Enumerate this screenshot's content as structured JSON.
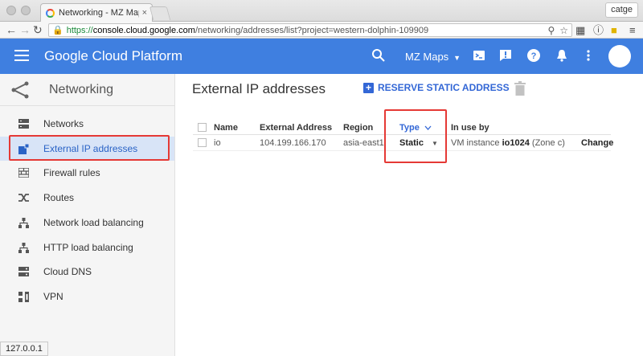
{
  "browser": {
    "tab_title": "Networking - MZ Maps",
    "tab_close": "×",
    "profile": "catge",
    "url_scheme": "https://",
    "url_host": "console.cloud.google.com",
    "url_rest": "/networking/addresses/list?project=western-dolphin-109909"
  },
  "appbar": {
    "brand": "Google Cloud Platform",
    "project": "MZ Maps",
    "color": "#3f7fe0"
  },
  "sidebar": {
    "title": "Networking",
    "items": [
      {
        "label": "Networks",
        "icon": "networks-icon"
      },
      {
        "label": "External IP addresses",
        "icon": "external-ip-icon"
      },
      {
        "label": "Firewall rules",
        "icon": "firewall-icon"
      },
      {
        "label": "Routes",
        "icon": "routes-icon"
      },
      {
        "label": "Network load balancing",
        "icon": "load-balancing-icon"
      },
      {
        "label": "HTTP load balancing",
        "icon": "load-balancing-icon"
      },
      {
        "label": "Cloud DNS",
        "icon": "dns-icon"
      },
      {
        "label": "VPN",
        "icon": "vpn-icon"
      }
    ]
  },
  "main": {
    "title": "External IP addresses",
    "reserve_label": "RESERVE STATIC ADDRESS",
    "table": {
      "headers": {
        "name": "Name",
        "address": "External Address",
        "region": "Region",
        "type": "Type",
        "in_use_by": "In use by"
      },
      "row": {
        "name": "io",
        "address": "104.199.166.170",
        "region": "asia-east1",
        "type": "Static",
        "in_use_prefix": "VM instance",
        "instance": "io1024",
        "zone": "(Zone c)",
        "action": "Change"
      }
    }
  },
  "status_bar": "127.0.0.1"
}
